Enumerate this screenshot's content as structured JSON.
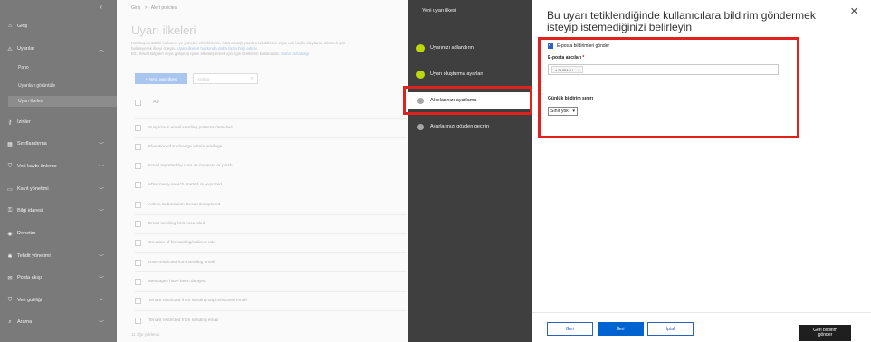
{
  "nav": {
    "items": [
      {
        "label": "Giriş",
        "icon": "home-icon"
      },
      {
        "label": "Uyarılar",
        "icon": "warning-icon"
      },
      {
        "label": "İzinler",
        "icon": "key-icon"
      },
      {
        "label": "Sınıflandırma",
        "icon": "grid-icon"
      },
      {
        "label": "Veri kaybı önleme",
        "icon": "shield-icon"
      },
      {
        "label": "Kayıt yönetimi",
        "icon": "folder-icon"
      },
      {
        "label": "Bilgi idaresi",
        "icon": "lock-icon"
      },
      {
        "label": "Denetim",
        "icon": "eye-icon"
      },
      {
        "label": "Tehdit yönetimi",
        "icon": "bug-icon"
      },
      {
        "label": "Posta akışı",
        "icon": "mail-icon"
      },
      {
        "label": "Veri gizliliği",
        "icon": "shield-icon"
      },
      {
        "label": "Arama",
        "icon": "search-icon"
      }
    ],
    "subitems": [
      "Pano",
      "Uyarıları görüntüle",
      "Uyarı ilkeleri"
    ]
  },
  "main": {
    "breadcrumb_home": "Giriş",
    "breadcrumb_sep": ">",
    "breadcrumb_current": "Alert policies",
    "title": "Uyarı ilkeleri",
    "desc_line1": "Kuruluşunuzdaki kullanıcı ve yönetici etkinliklerini, kötü amaçlı yazılım tehditlerini veya veri kaybı olaylarını izlemek için",
    "desc_line2_a": "belirleyerek ilkeyi izleyin. ",
    "desc_line2_link": "Uyarı ilkeleri hakkında daha fazla bilgi edinin",
    "desc_line3_a": "E5, Tehdit Bilgileri veya gelişmiş işlevi etkinleştirmek için ilgili özellikleri kullanabilir. ",
    "desc_line3_link": "Daha fazla bilgi",
    "new_button": "+ Yeni uyarı ilkesi",
    "search_placeholder": "Arama",
    "column_header": "Ad",
    "rows": [
      "Suspicious email sending patterns detected",
      "Elevation of Exchange admin privilege",
      "Email reported by user as malware or phish",
      "eDiscovery search started or exported",
      "Admin Submission Result Completed",
      "Email sending limit exceeded",
      "Creation of forwarding/redirect rule",
      "User restricted from sending email",
      "Messages have been delayed",
      "Tenant restricted from sending unprovisioned email",
      "Tenant restricted from sending email"
    ],
    "footer": "11 öğe yüklendi."
  },
  "wizard": {
    "title": "Yeni uyarı ilkesi",
    "steps": [
      {
        "label": "Uyarınızı adlandırın",
        "state": "done"
      },
      {
        "label": "Uyarı oluşturma ayarları",
        "state": "done"
      },
      {
        "label": "Alıcılarınızı ayarlama",
        "state": "current"
      },
      {
        "label": "Ayarlarınızı gözden geçirin",
        "state": "todo"
      }
    ]
  },
  "panel": {
    "title": "Bu uyarı tetiklendiğinde kullanıcılara bildirim göndermek isteyip istemediğinizi belirleyin",
    "checkbox_label": "E-posta bildirimleri gönder",
    "recipients_label": "E-posta alıcıları",
    "required_mark": "*",
    "chip_text": "+ DURAN /",
    "chip_close": "×",
    "daily_limit_label": "Günlük bildirim sınırı",
    "daily_limit_value": "Sınır yok",
    "back_button": "Geri",
    "next_button": "İleri",
    "cancel_button": "İptal",
    "feedback_line1": "Geri bildirim",
    "feedback_line2": "gönder"
  },
  "colors": {
    "highlight": "#e0221f",
    "step_done": "#bad80a",
    "primary": "#0063cf"
  }
}
